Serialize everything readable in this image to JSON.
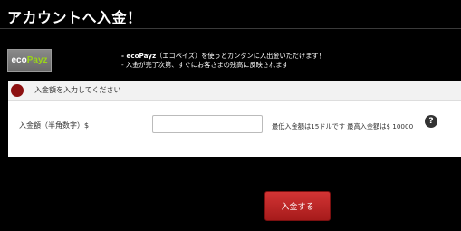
{
  "header": {
    "title": "アカウントへ入金！"
  },
  "payment_method": {
    "logo_part1": "eco",
    "logo_part2": "Payz",
    "info_line1_brand": "- ecoPayz",
    "info_line1_rest": "（エコペイズ）を使うとカンタンに入出金いただけます！",
    "info_line2": "- 入金が完了次第、すぐにお客さまの残高に反映されます"
  },
  "form": {
    "section_header": "入金額を入力してください",
    "amount_label": "入金額（半角数字）$",
    "amount_value": "",
    "amount_placeholder": "",
    "limits_text": "最低入金額は15ドルです 最高入金額は$ 10000",
    "help_icon_glyph": "?"
  },
  "actions": {
    "submit_label": "入金する"
  },
  "colors": {
    "background": "#000000",
    "panel": "#ffffff",
    "accent_red": "#c0282a",
    "header_icon": "#8c1010",
    "logo_green": "#9ad41a"
  }
}
